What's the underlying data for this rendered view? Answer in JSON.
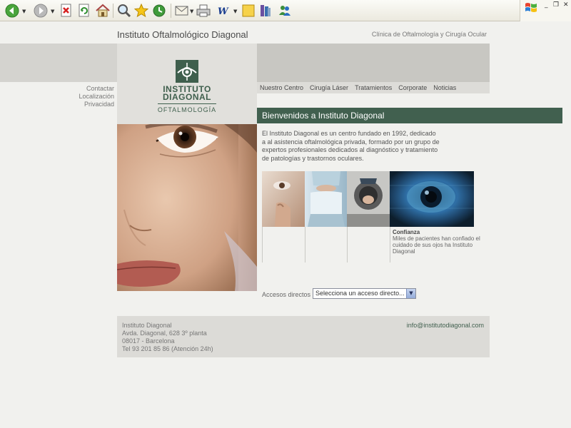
{
  "browser": {
    "icons": [
      "back-icon",
      "forward-icon",
      "stop-icon",
      "refresh-icon",
      "home-icon",
      "search-icon",
      "favorites-icon",
      "history-icon",
      "mail-icon",
      "print-icon",
      "edit-icon",
      "notes-icon",
      "research-icon",
      "messenger-icon"
    ],
    "window_controls": [
      "minimize",
      "restore",
      "close"
    ]
  },
  "header": {
    "title": "Instituto Oftalmológico Diagonal",
    "tagline": "Clínica de Oftalmología y Cirugía Ocular"
  },
  "logo": {
    "line1": "INSTITUTO",
    "line2": "DIAGONAL",
    "line3": "OFTALMOLOGÍA"
  },
  "side_links": [
    {
      "label": "Contactar"
    },
    {
      "label": "Localización"
    },
    {
      "label": "Privacidad"
    }
  ],
  "nav": [
    {
      "label": "Nuestro Centro"
    },
    {
      "label": "Cirugía Láser"
    },
    {
      "label": "Tratamientos"
    },
    {
      "label": "Corporate"
    },
    {
      "label": "Noticias"
    }
  ],
  "welcome": {
    "title": "Bienvenidos a Instituto Diagonal",
    "text": "El Instituto Diagonal es un centro fundado en 1992, dedicado a al asistencia oftalmológica privada, formado por un grupo de expertos profesionales dedicados al diagnóstico y tratamiento de patologías y trastornos oculares."
  },
  "feature": {
    "title": "Confianza",
    "text": "Miles de pacientes han confiado el cuidado de sus ojos ha Instituto Diagonal"
  },
  "quick_access": {
    "label": "Accesos directos",
    "selected": "Selecciona un acceso directo..."
  },
  "footer": {
    "lines": [
      "Instituto Diagonal",
      "Avda. Diagonal, 628 3º planta",
      "08017 - Barcelona",
      "Tel 93 201 85 86 (Atención 24h)"
    ],
    "email": "info@institutodiagonal.com"
  },
  "colors": {
    "brand_green": "#41604f",
    "page_bg": "#f1f1ee",
    "band_gray": "#c8c7c2"
  }
}
